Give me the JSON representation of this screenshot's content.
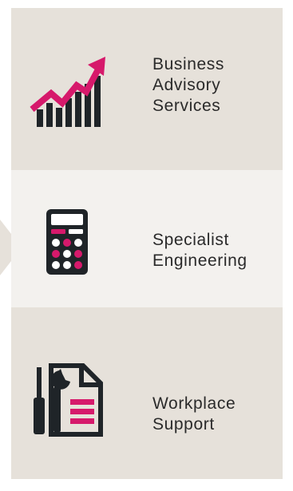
{
  "services": [
    {
      "icon": "growth-chart-icon",
      "label_lines": [
        "Business",
        "Advisory",
        "Services"
      ]
    },
    {
      "icon": "calculator-icon",
      "label_lines": [
        "Specialist",
        "Engineering"
      ]
    },
    {
      "icon": "tools-document-icon",
      "label_lines": [
        "Workplace",
        "Support"
      ]
    }
  ],
  "colors": {
    "panel_dark": "#e6e1da",
    "panel_light": "#f3f1ee",
    "icon_dark": "#1f2428",
    "accent_pink": "#d6196b",
    "text": "#2a2a2a"
  }
}
